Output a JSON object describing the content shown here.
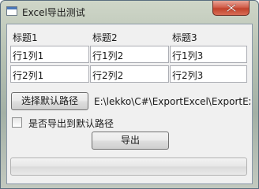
{
  "window": {
    "title": "Excel导出测试"
  },
  "grid": {
    "headers": [
      "标题1",
      "标题2",
      "标题3"
    ],
    "rows": [
      [
        "行1列1",
        "行1列2",
        "行1列3"
      ],
      [
        "行2列1",
        "行2列2",
        "行2列3"
      ]
    ]
  },
  "path_row": {
    "button_label": "选择默认路径",
    "path_value": "E:\\lekko\\C#\\ExportExcel\\ExportEx"
  },
  "option": {
    "checkbox_label": "是否导出到默认路径",
    "checked": false
  },
  "export": {
    "button_label": "导出"
  },
  "progress": {
    "value_fraction": 0
  },
  "colors": {
    "close_button": "#c1422c",
    "progress_fill": "#06b025"
  },
  "icons": {
    "app": "app-window-icon",
    "close": "close-icon"
  }
}
